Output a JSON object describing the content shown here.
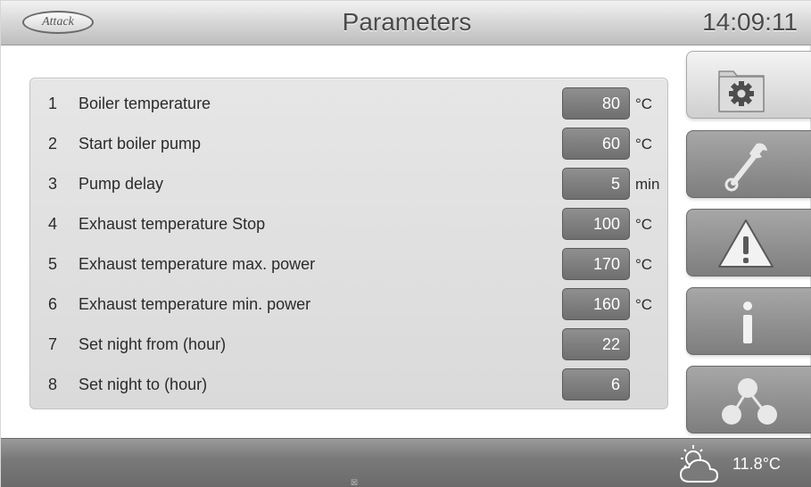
{
  "header": {
    "logo_text": "Attack",
    "title": "Parameters",
    "clock": "14:09:11"
  },
  "parameters": [
    {
      "num": "1",
      "label": "Boiler temperature",
      "value": "80",
      "unit": "°C"
    },
    {
      "num": "2",
      "label": "Start boiler pump",
      "value": "60",
      "unit": "°C"
    },
    {
      "num": "3",
      "label": "Pump delay",
      "value": "5",
      "unit": "min"
    },
    {
      "num": "4",
      "label": "Exhaust temperature Stop",
      "value": "100",
      "unit": "°C"
    },
    {
      "num": "5",
      "label": "Exhaust temperature max. power",
      "value": "170",
      "unit": "°C"
    },
    {
      "num": "6",
      "label": "Exhaust temperature min. power",
      "value": "160",
      "unit": "°C"
    },
    {
      "num": "7",
      "label": "Set night from (hour)",
      "value": "22",
      "unit": ""
    },
    {
      "num": "8",
      "label": "Set night to (hour)",
      "value": "6",
      "unit": ""
    }
  ],
  "side_nav": [
    {
      "icon": "settings-folder-icon",
      "active": true
    },
    {
      "icon": "wrench-icon",
      "active": false
    },
    {
      "icon": "warning-icon",
      "active": false
    },
    {
      "icon": "info-icon",
      "active": false
    },
    {
      "icon": "network-icon",
      "active": false
    }
  ],
  "footer": {
    "weather_icon": "partly-cloudy-icon",
    "outside_temp": "11.8°C",
    "marker": "☒"
  },
  "colors": {
    "header_text": "#4a4a4a",
    "value_box": "#7f7f7f",
    "footer": "#7a7a7a"
  }
}
